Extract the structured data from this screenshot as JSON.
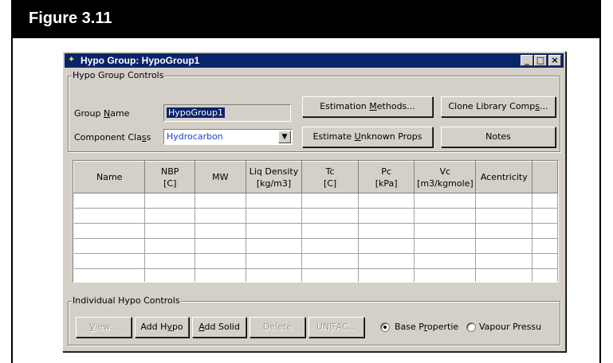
{
  "figure": {
    "title": "Figure 3.11"
  },
  "window": {
    "title": "Hypo Group: HypoGroup1",
    "controls": {
      "minimize": "_",
      "maximize": "□",
      "close": "×"
    }
  },
  "hypo_group_controls": {
    "legend": "Hypo Group Controls",
    "group_name_label": "Group Name",
    "group_name_value": "HypoGroup1",
    "component_class_label": "Component Class",
    "component_class_value": "Hydrocarbon",
    "buttons": {
      "estimation_methods": "Estimation Methods...",
      "clone_library_comps": "Clone Library Comps...",
      "estimate_unknown_props": "Estimate Unknown Props",
      "notes": "Notes"
    }
  },
  "grid": {
    "columns": [
      "Name",
      "NBP\n[C]",
      "MW",
      "Liq Density\n[kg/m3]",
      "Tc\n[C]",
      "Pc\n[kPa]",
      "Vc\n[m3/kgmole]",
      "Acentricity",
      ""
    ],
    "row_count": 6
  },
  "individual_hypo_controls": {
    "legend": "Individual Hypo Controls",
    "buttons": {
      "view": "View...",
      "add_hypo": "Add Hypo",
      "add_solid": "Add Solid",
      "delete": "Delete",
      "unifac": "UNIFAC..."
    },
    "radio_base": "Base Propertie",
    "radio_vapour": "Vapour Pressu"
  }
}
